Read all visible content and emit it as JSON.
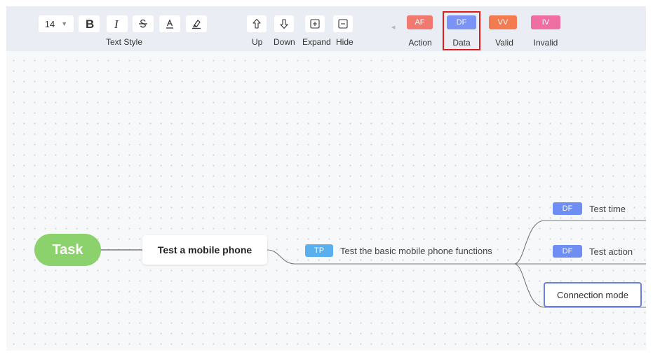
{
  "toolbar": {
    "font_size": "14",
    "text_style_label": "Text Style",
    "text_style_buttons": [
      "bold-icon",
      "italic-icon",
      "strikethrough-icon",
      "font-color-icon",
      "highlight-icon"
    ],
    "node_buttons": [
      "arrow-up-icon",
      "arrow-down-icon",
      "expand-icon",
      "collapse-icon"
    ],
    "up_label": "Up",
    "down_label": "Down",
    "expand_label": "Expand",
    "hide_label": "Hide",
    "markers": [
      {
        "tag": "AF",
        "label": "Action",
        "color": "#f07a70"
      },
      {
        "tag": "DF",
        "label": "Data",
        "color": "#7b93f5",
        "selected": true
      },
      {
        "tag": "VV",
        "label": "Valid",
        "color": "#f47a4f"
      },
      {
        "tag": "IV",
        "label": "Invalid",
        "color": "#f06fa2"
      }
    ]
  },
  "mindmap": {
    "root": "Task",
    "main": "Test a mobile phone",
    "tp_tag": "TP",
    "tp_text": "Test the basic mobile phone functions",
    "children": [
      {
        "tag": "DF",
        "text": "Test time"
      },
      {
        "tag": "DF",
        "text": "Test action"
      },
      {
        "text": "Connection mode"
      }
    ],
    "colors": {
      "root": "#8bd16c",
      "tp_tag": "#5aafef",
      "df_tag": "#6e8ef3",
      "selected_border": "#6a7fe0"
    }
  }
}
